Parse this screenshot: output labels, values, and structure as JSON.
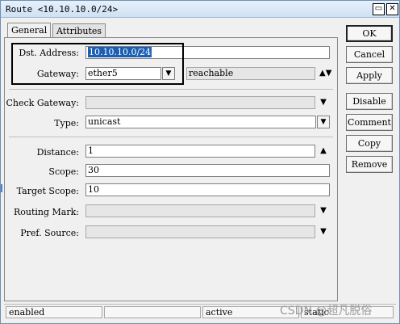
{
  "window": {
    "title": "Route <10.10.10.0/24>",
    "restore_icon": "restore-icon",
    "close_icon": "close-icon"
  },
  "tabs": [
    {
      "label": "General",
      "active": true
    },
    {
      "label": "Attributes",
      "active": false
    }
  ],
  "form": {
    "dst_address": {
      "label": "Dst. Address:",
      "value": "10.10.10.0/24"
    },
    "gateway": {
      "label": "Gateway:",
      "value": "ether5",
      "status": "reachable"
    },
    "check_gateway": {
      "label": "Check Gateway:",
      "value": ""
    },
    "type": {
      "label": "Type:",
      "value": "unicast"
    },
    "distance": {
      "label": "Distance:",
      "value": "1"
    },
    "scope": {
      "label": "Scope:",
      "value": "30"
    },
    "target_scope": {
      "label": "Target Scope:",
      "value": "10"
    },
    "routing_mark": {
      "label": "Routing Mark:",
      "value": ""
    },
    "pref_source": {
      "label": "Pref. Source:",
      "value": ""
    }
  },
  "buttons": {
    "ok": "OK",
    "cancel": "Cancel",
    "apply": "Apply",
    "disable": "Disable",
    "comment": "Comment",
    "copy": "Copy",
    "remove": "Remove"
  },
  "status_bar": {
    "state": "enabled",
    "active": "active",
    "static": "static"
  },
  "watermark": "CSDN @超凡脱俗"
}
